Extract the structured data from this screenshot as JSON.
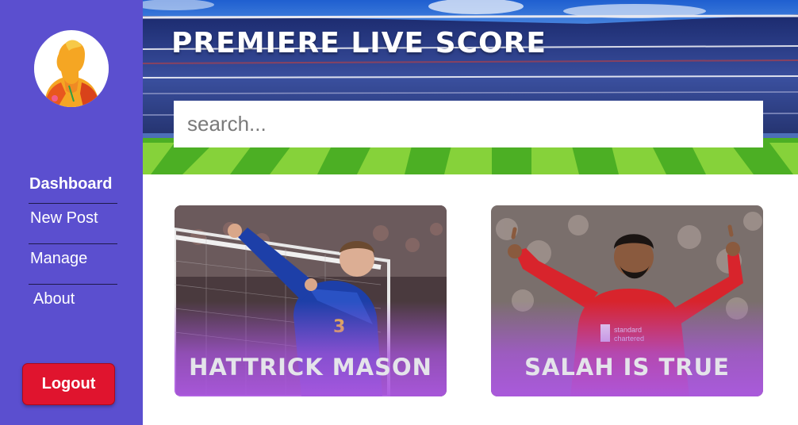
{
  "sidebar": {
    "avatar_icon": "user-avatar",
    "nav": [
      {
        "label": "Dashboard",
        "active": true
      },
      {
        "label": "New Post",
        "active": false
      },
      {
        "label": "Manage",
        "active": false
      },
      {
        "label": "About",
        "active": false
      }
    ],
    "logout_label": "Logout"
  },
  "header": {
    "title": "PREMIERE LIVE SCORE",
    "search_placeholder": "search..."
  },
  "cards": [
    {
      "title": "HATTRICK MASON",
      "kit_color": "#1d3fa8"
    },
    {
      "title": "SALAH IS TRUE",
      "kit_color": "#d8242c"
    }
  ],
  "colors": {
    "sidebar": "#5b4fcf",
    "logout": "#e0142e",
    "card_overlay": "#a855dc"
  }
}
